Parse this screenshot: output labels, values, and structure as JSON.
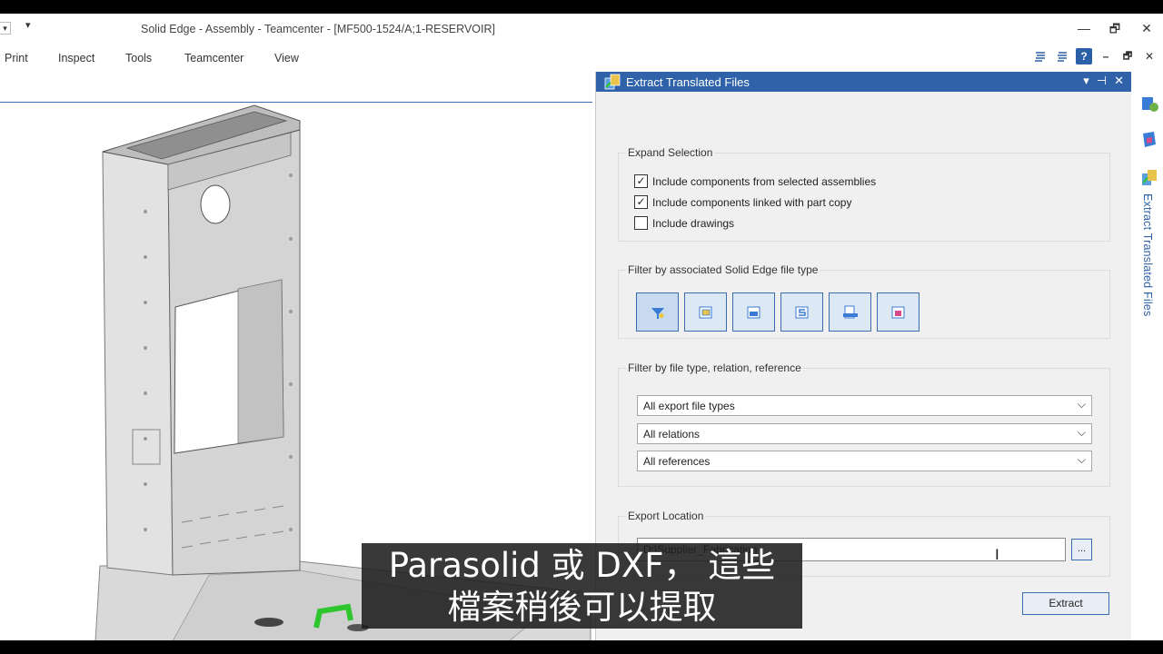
{
  "titlebar": {
    "qa_menu_glyph": "▾",
    "title": "Solid Edge - Assembly - Teamcenter - [MF500-1524/A;1-RESERVOIR]",
    "minimize": "—",
    "restore": "🗗",
    "close": "✕"
  },
  "ribbon": {
    "tabs": [
      "Print",
      "Inspect",
      "Tools",
      "Teamcenter",
      "View"
    ],
    "help": "?",
    "doc_minimize": "–",
    "doc_restore": "🗗",
    "doc_close": "✕"
  },
  "panel": {
    "title": "Extract Translated Files",
    "header_buttons": [
      "▾",
      "⊣",
      "✕"
    ],
    "expand_selection": {
      "label": "Expand Selection",
      "options": [
        {
          "label": "Include components from selected assemblies",
          "checked": true
        },
        {
          "label": "Include components linked with part copy",
          "checked": true
        },
        {
          "label": "Include drawings",
          "checked": false
        }
      ]
    },
    "filter_associated": {
      "label": "Filter by associated Solid Edge file type",
      "buttons": [
        "all-types-icon",
        "assembly-file-icon",
        "part-file-icon",
        "sheetmetal-file-icon",
        "weldment-file-icon",
        "draft-file-icon"
      ]
    },
    "filter_file": {
      "label": "Filter by file type, relation, reference",
      "dropdowns": [
        "All export file types",
        "All relations",
        "All references"
      ]
    },
    "export_location": {
      "label": "Export Location",
      "value": "D:\\Supplier_Fabrication",
      "browse_label": "..."
    },
    "extract_label": "Extract"
  },
  "strip": {
    "label": "Extract Translated Files"
  },
  "subtitle": {
    "line1": "Parasolid 或 DXF， 這些",
    "line2": "檔案稍後可以提取"
  },
  "colors": {
    "accent": "#2f62a8",
    "panel_bg": "#f0f0f0"
  }
}
